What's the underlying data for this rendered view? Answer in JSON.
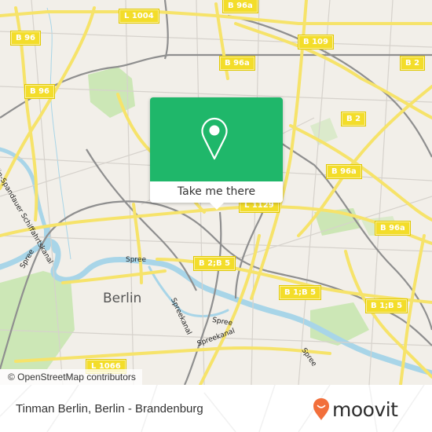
{
  "map": {
    "city_label": "Berlin",
    "road_labels": [
      {
        "id": "l1004",
        "text": "L 1004"
      },
      {
        "id": "b96a-top",
        "text": "B 96a"
      },
      {
        "id": "b96-1",
        "text": "B 96"
      },
      {
        "id": "b109",
        "text": "B 109"
      },
      {
        "id": "b96a-2",
        "text": "B 96a"
      },
      {
        "id": "b2-right",
        "text": "B 2"
      },
      {
        "id": "b96-2",
        "text": "B 96"
      },
      {
        "id": "b2-mid",
        "text": "B 2"
      },
      {
        "id": "b96a-3",
        "text": "B 96a"
      },
      {
        "id": "l1129",
        "text": "L 1129"
      },
      {
        "id": "b96a-4",
        "text": "B 96a"
      },
      {
        "id": "b2b5",
        "text": "B 2;B 5"
      },
      {
        "id": "b1b5-1",
        "text": "B 1;B 5"
      },
      {
        "id": "b1b5-2",
        "text": "B 1;B 5"
      },
      {
        "id": "l1066",
        "text": "L 1066"
      }
    ],
    "water_labels": [
      {
        "id": "spree-1",
        "text": "Spree"
      },
      {
        "id": "spree-2",
        "text": "Spree"
      },
      {
        "id": "spree-3",
        "text": "Spree"
      },
      {
        "id": "spree-4",
        "text": "Spree"
      },
      {
        "id": "spreekanal-1",
        "text": "Spreekanal"
      },
      {
        "id": "spreekanal-2",
        "text": "Spreekanal"
      },
      {
        "id": "schiffahrtskanal",
        "text": "Berlin-Spandauer Schiffahrtskanal"
      }
    ],
    "attribution": "© OpenStreetMap contributors"
  },
  "popup": {
    "icon": "location-pin-icon",
    "button_label": "Take me there",
    "accent_color": "#1fb76a"
  },
  "footer": {
    "place_title": "Tinman Berlin, Berlin - Brandenburg",
    "brand": "moovit",
    "brand_color": "#f26f3b"
  }
}
